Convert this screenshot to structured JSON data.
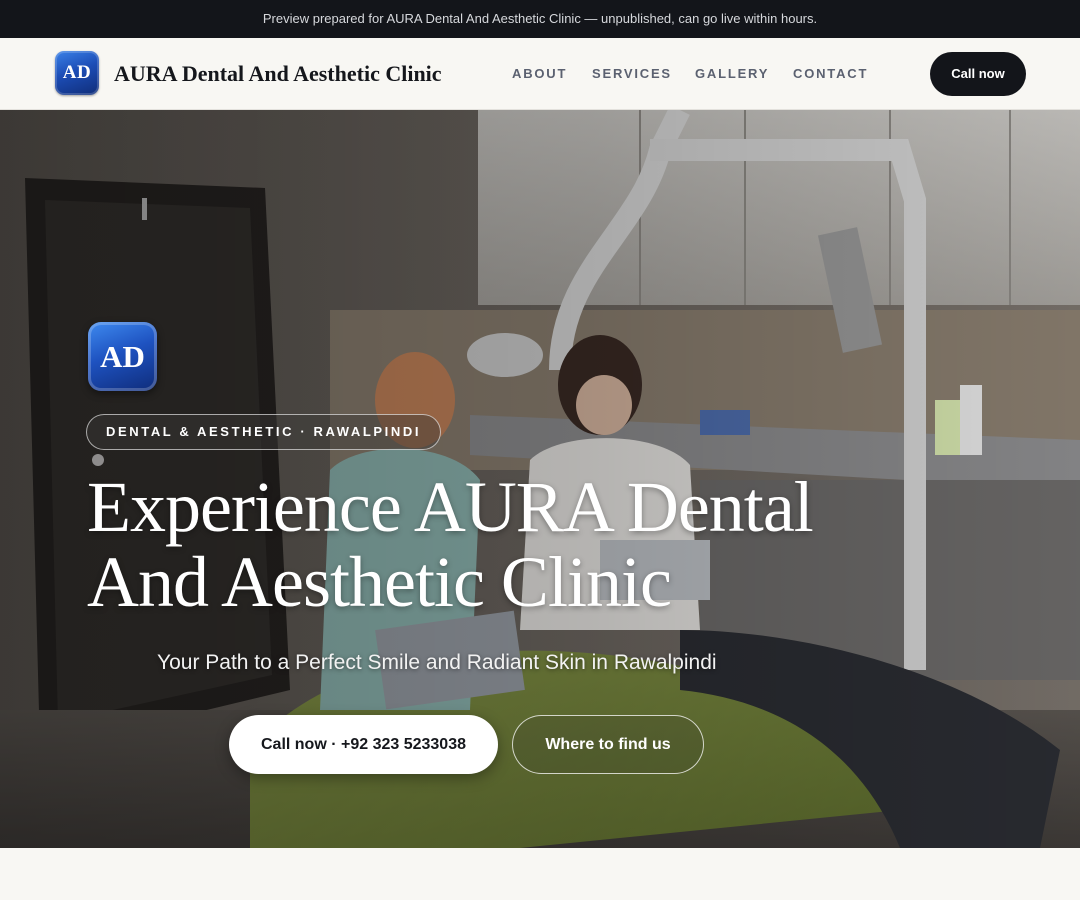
{
  "preview_banner": {
    "text": "Preview prepared for AURA Dental And Aesthetic Clinic — unpublished, can go live within hours."
  },
  "header": {
    "logo_text": "AD",
    "brand_name": "AURA Dental And Aesthetic Clinic",
    "nav": [
      {
        "label": "ABOUT"
      },
      {
        "label": "SERVICES"
      },
      {
        "label": "GALLERY"
      },
      {
        "label": "CONTACT"
      }
    ],
    "cta_label": "Call now"
  },
  "hero": {
    "logo_text": "AD",
    "tagline": "DENTAL & AESTHETIC · RAWALPINDI",
    "title": "Experience AURA Dental And Aesthetic Clinic",
    "subtitle": "Your Path to a Perfect Smile and Radiant Skin in Rawalpindi",
    "primary_button": "Call now · +92 323 5233038",
    "secondary_button": "Where to find us",
    "background_image": "dental-clinic-treatment-room-photo"
  },
  "colors": {
    "banner_bg": "#13151a",
    "page_bg": "#f8f7f3",
    "brand_blue": "#1e52c0",
    "nav_text": "#5b6170",
    "cta_dark": "#13151a"
  }
}
